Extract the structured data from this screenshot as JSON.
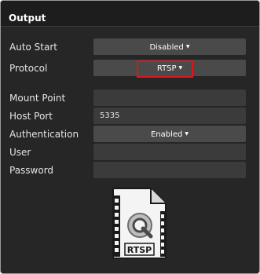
{
  "panel": {
    "title": "Output"
  },
  "fields": {
    "auto_start": {
      "label": "Auto Start",
      "value": "Disabled"
    },
    "protocol": {
      "label": "Protocol",
      "value": "RTSP"
    },
    "mount_point": {
      "label": "Mount Point",
      "value": ""
    },
    "host_port": {
      "label": "Host Port",
      "value": "5335"
    },
    "authentication": {
      "label": "Authentication",
      "value": "Enabled"
    },
    "user": {
      "label": "User",
      "value": ""
    },
    "password": {
      "label": "Password",
      "value": ""
    }
  },
  "file_icon": {
    "label": "RTSP",
    "icon": "rtsp-file-icon"
  },
  "colors": {
    "highlight": "#e0151a",
    "panel_bg": "#262626",
    "dropdown_bg": "#4a4a4a",
    "input_bg": "#3b3b3b"
  }
}
